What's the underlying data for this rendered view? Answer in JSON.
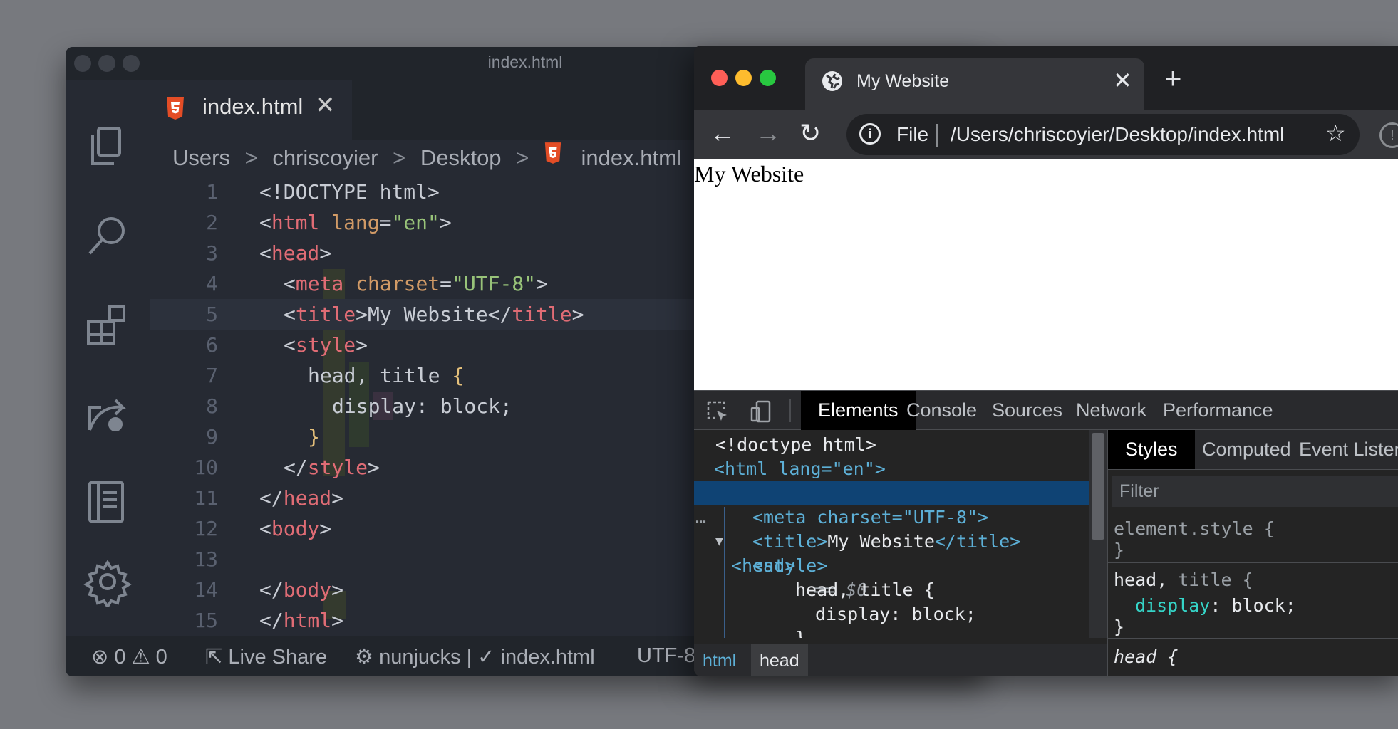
{
  "vscode": {
    "window_title": "index.html",
    "tab": {
      "label": "index.html",
      "close": "✕"
    },
    "breadcrumb": [
      "Users",
      "chriscoyier",
      "Desktop",
      "index.html"
    ],
    "breadcrumb_sep": ">",
    "code_lines": [
      {
        "n": "1"
      },
      {
        "n": "2"
      },
      {
        "n": "3"
      },
      {
        "n": "4"
      },
      {
        "n": "5"
      },
      {
        "n": "6"
      },
      {
        "n": "7"
      },
      {
        "n": "8"
      },
      {
        "n": "9"
      },
      {
        "n": "10"
      },
      {
        "n": "11"
      },
      {
        "n": "12"
      },
      {
        "n": "13"
      },
      {
        "n": "14"
      },
      {
        "n": "15"
      }
    ],
    "code": {
      "l1": "<!DOCTYPE html>",
      "l2_tag": "html",
      "l2_attr": "lang",
      "l2_val": "\"en\"",
      "l3_tag": "head",
      "l4_tag": "meta",
      "l4_attr": "charset",
      "l4_val": "\"UTF-8\"",
      "l5_tag": "title",
      "l5_text": "My Website",
      "l5_close": "title",
      "l6_tag": "style",
      "l7_sel": "head, title",
      "l7_brace": "{",
      "l8_decl": "display: block;",
      "l9_brace": "}",
      "l10_tag": "style",
      "l11_tag": "head",
      "l12_tag": "body",
      "l14_tag": "body",
      "l15_tag": "html"
    },
    "status": {
      "errors": "0",
      "warnings": "0",
      "live_share": "Live Share",
      "nunjucks": "nunjucks |",
      "file": "index.html",
      "encoding": "UTF-8"
    }
  },
  "chrome": {
    "tab_title": "My Website",
    "tab_close": "✕",
    "new_tab": "+",
    "omnibox": {
      "scheme": "File",
      "url": "/Users/chriscoyier/Desktop/index.html"
    },
    "page_heading": "My Website",
    "devtools": {
      "tabs": [
        "Elements",
        "Console",
        "Sources",
        "Network",
        "Performance"
      ],
      "dom": {
        "doctype": "<!doctype html>",
        "html_open": "<html lang=\"en\">",
        "head_tag": "<head>",
        "head_marker": "== $0",
        "meta": "<meta charset=\"UTF-8\">",
        "title_open": "<title>",
        "title_text": "My Website",
        "title_close": "</title>",
        "style_open": "<style>",
        "css_sel": "head, title {",
        "css_decl": "display: block;",
        "css_close": "}"
      },
      "crumbs": [
        "html",
        "head"
      ],
      "styles_tabs": [
        "Styles",
        "Computed",
        "Event Listeners"
      ],
      "filter_placeholder": "Filter",
      "rules": {
        "element_style": "element.style {",
        "close": "}",
        "sel_head": "head,",
        "sel_title": "title {",
        "prop": "display",
        "val": "block;",
        "ua_sel": "head {"
      }
    }
  }
}
